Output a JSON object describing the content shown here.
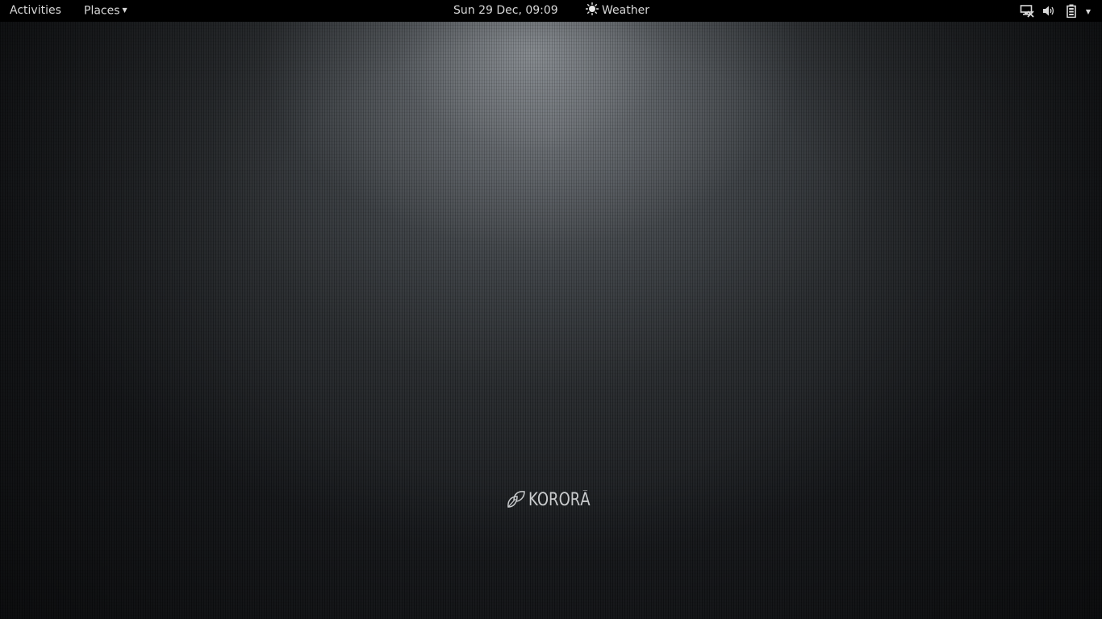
{
  "topbar": {
    "activities_label": "Activities",
    "places_label": "Places",
    "clock": "Sun 29 Dec, 09:09",
    "weather_label": "Weather"
  },
  "tray": {
    "icons": [
      "network-icon",
      "volume-icon",
      "battery-icon",
      "system-menu-caret-icon"
    ]
  },
  "desktop": {
    "logo_text": "KORORĀ"
  },
  "colors": {
    "topbar_bg": "#000000",
    "topbar_text": "#d8d8d8",
    "wallpaper_highlight": "#9a9ea3",
    "wallpaper_base": "#15171a"
  }
}
